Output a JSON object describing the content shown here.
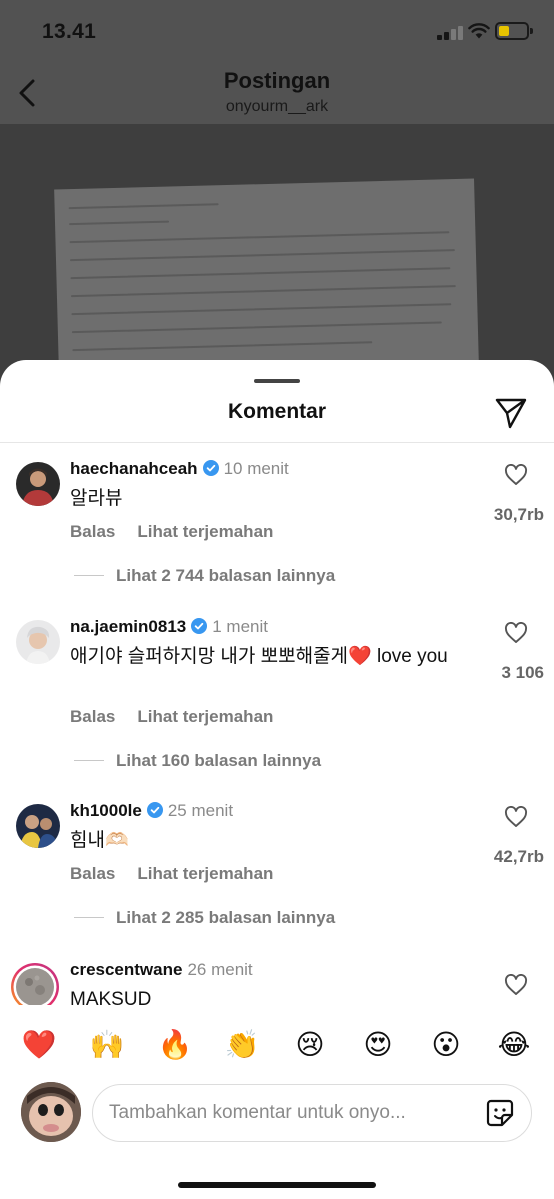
{
  "status_bar": {
    "time": "13.41",
    "battery_color": "#e7c400"
  },
  "post_header": {
    "title": "Postingan",
    "subtitle": "onyourm__ark"
  },
  "sheet": {
    "title": "Komentar"
  },
  "comments": [
    {
      "username": "haechanahceah",
      "verified": true,
      "time": "10 menit",
      "text": "알라뷰",
      "actions": [
        "Balas",
        "Lihat terjemahan"
      ],
      "likes": "30,7rb",
      "more_replies": "Lihat 2 744 balasan lainnya"
    },
    {
      "username": "na.jaemin0813",
      "verified": true,
      "time": "1 menit",
      "text": "애기야 슬퍼하지망 내가 뽀뽀해줄게❤️ love you",
      "actions": [
        "Balas",
        "Lihat terjemahan"
      ],
      "likes": "3 106",
      "more_replies": "Lihat 160 balasan lainnya"
    },
    {
      "username": "kh1000le",
      "verified": true,
      "time": "25 menit",
      "text": "힘내🫶🏻",
      "actions": [
        "Balas",
        "Lihat terjemahan"
      ],
      "likes": "42,7rb",
      "more_replies": "Lihat 2 285 balasan lainnya"
    },
    {
      "username": "crescentwane",
      "verified": false,
      "time": "26 menit",
      "text": "MAKSUD",
      "has_story_ring": true
    }
  ],
  "quick_reactions": [
    "❤️",
    "🙌",
    "🔥",
    "👏",
    "😢",
    "😍",
    "😮",
    "😂"
  ],
  "composer": {
    "placeholder": "Tambahkan komentar untuk onyo..."
  },
  "colors": {
    "verified": "#3897f0",
    "story_ring": "#e1306c",
    "dim_overlay": "#525252"
  }
}
